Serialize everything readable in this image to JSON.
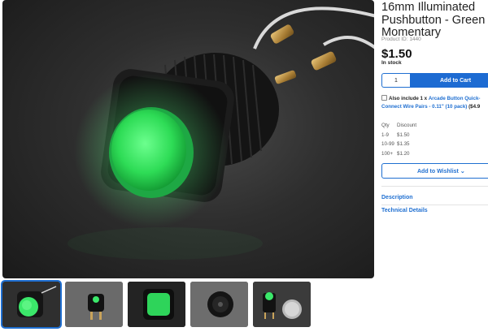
{
  "product": {
    "title": "16mm Illuminated Pushbutton - Green Momentary",
    "product_id": "Product ID: 1440",
    "price": "$1.50",
    "stock": "In stock"
  },
  "cart": {
    "quantity": "1",
    "add_to_cart": "Add to Cart"
  },
  "addon": {
    "prefix": "Also include 1 x",
    "link": "Arcade Button Quick-Connect Wire Pairs - 0.11\" (10 pack)",
    "price": "($4.9"
  },
  "discount": {
    "headers": [
      "Qty",
      "Discount"
    ],
    "rows": [
      [
        "1-9",
        "$1.50"
      ],
      [
        "10-99",
        "$1.35"
      ],
      [
        "100+",
        "$1.20"
      ]
    ]
  },
  "wishlist": {
    "label": "Add to Wishlist ⌄"
  },
  "sections": {
    "description": "Description",
    "technical": "Technical Details"
  },
  "colors": {
    "accent": "#1d6bd2",
    "led_green": "#3be86a"
  },
  "icons": [
    "chevron-down-icon",
    "checkbox-icon"
  ]
}
